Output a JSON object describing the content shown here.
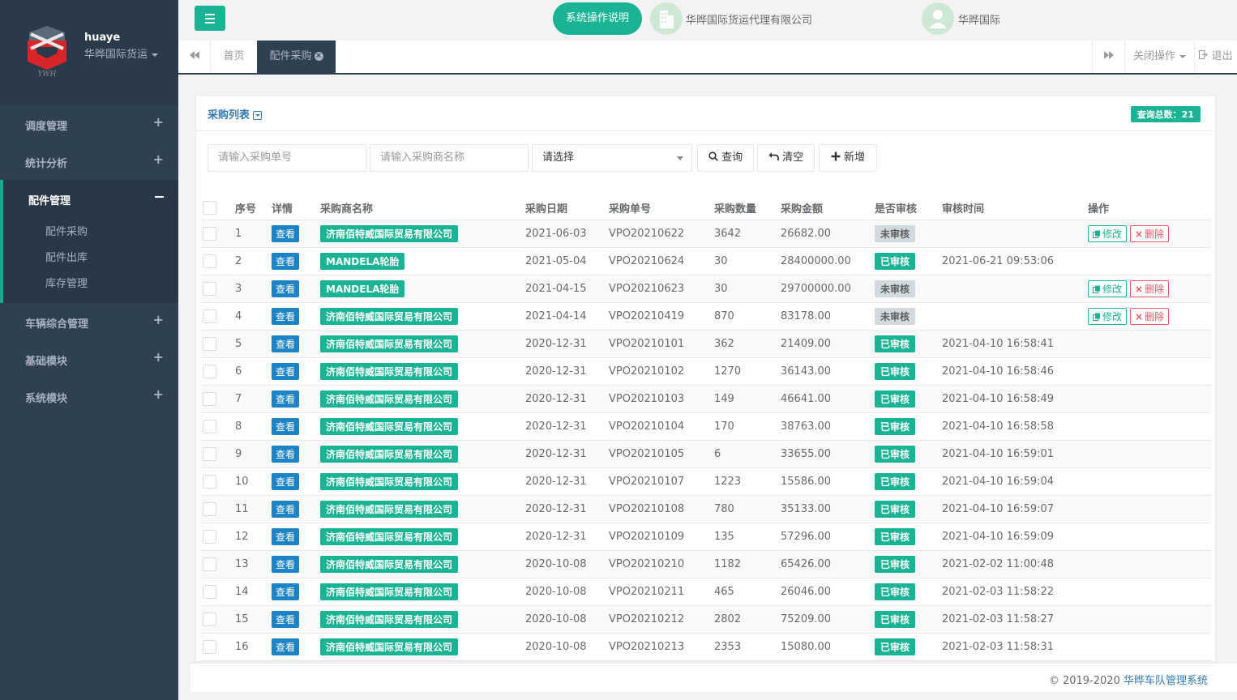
{
  "sidebar": {
    "user": "huaye",
    "org": "华晔国际货运",
    "menu": [
      {
        "label": "调度管理",
        "icon": "plus-icon"
      },
      {
        "label": "统计分析",
        "icon": "plus-icon"
      }
    ],
    "active_group": {
      "label": "配件管理",
      "items": [
        "配件采购",
        "配件出库",
        "库存管理"
      ]
    },
    "menu_after": [
      {
        "label": "车辆综合管理"
      },
      {
        "label": "基础模块"
      },
      {
        "label": "系统模块"
      }
    ]
  },
  "topbar": {
    "help_label": "系统操作说明",
    "company": "华晔国际货运代理有限公司",
    "user_label": "华晔国际"
  },
  "tabs": {
    "home": "首页",
    "active": "配件采购",
    "close_ops": "关闭操作",
    "logout": "退出"
  },
  "panel": {
    "title": "采购列表",
    "count_label": "查询总数：21"
  },
  "search": {
    "order_placeholder": "请输入采购单号",
    "supplier_placeholder": "请输入采购商名称",
    "select_value": "请选择",
    "query_label": "查询",
    "clear_label": "清空",
    "add_label": "新增"
  },
  "table": {
    "headers": [
      "序号",
      "详情",
      "采购商名称",
      "采购日期",
      "采购单号",
      "采购数量",
      "采购金额",
      "是否审核",
      "审核时间",
      "操作"
    ],
    "view_label": "查看",
    "edit_label": "修改",
    "delete_label": "删除",
    "rows": [
      {
        "no": "1",
        "supplier": "济南佰特威国际贸易有限公司",
        "date": "2021-06-03",
        "order": "VPO20210622",
        "qty": "3642",
        "amount": "26682.00",
        "status": "未审核",
        "approved": false,
        "time": ""
      },
      {
        "no": "2",
        "supplier": "MANDELA轮胎",
        "date": "2021-05-04",
        "order": "VPO20210624",
        "qty": "30",
        "amount": "28400000.00",
        "status": "已审核",
        "approved": true,
        "time": "2021-06-21 09:53:06"
      },
      {
        "no": "3",
        "supplier": "MANDELA轮胎",
        "date": "2021-04-15",
        "order": "VPO20210623",
        "qty": "30",
        "amount": "29700000.00",
        "status": "未审核",
        "approved": false,
        "time": ""
      },
      {
        "no": "4",
        "supplier": "济南佰特威国际贸易有限公司",
        "date": "2021-04-14",
        "order": "VPO20210419",
        "qty": "870",
        "amount": "83178.00",
        "status": "未审核",
        "approved": false,
        "time": ""
      },
      {
        "no": "5",
        "supplier": "济南佰特威国际贸易有限公司",
        "date": "2020-12-31",
        "order": "VPO20210101",
        "qty": "362",
        "amount": "21409.00",
        "status": "已审核",
        "approved": true,
        "time": "2021-04-10 16:58:41"
      },
      {
        "no": "6",
        "supplier": "济南佰特威国际贸易有限公司",
        "date": "2020-12-31",
        "order": "VPO20210102",
        "qty": "1270",
        "amount": "36143.00",
        "status": "已审核",
        "approved": true,
        "time": "2021-04-10 16:58:46"
      },
      {
        "no": "7",
        "supplier": "济南佰特威国际贸易有限公司",
        "date": "2020-12-31",
        "order": "VPO20210103",
        "qty": "149",
        "amount": "46641.00",
        "status": "已审核",
        "approved": true,
        "time": "2021-04-10 16:58:49"
      },
      {
        "no": "8",
        "supplier": "济南佰特威国际贸易有限公司",
        "date": "2020-12-31",
        "order": "VPO20210104",
        "qty": "170",
        "amount": "38763.00",
        "status": "已审核",
        "approved": true,
        "time": "2021-04-10 16:58:58"
      },
      {
        "no": "9",
        "supplier": "济南佰特威国际贸易有限公司",
        "date": "2020-12-31",
        "order": "VPO20210105",
        "qty": "6",
        "amount": "33655.00",
        "status": "已审核",
        "approved": true,
        "time": "2021-04-10 16:59:01"
      },
      {
        "no": "10",
        "supplier": "济南佰特威国际贸易有限公司",
        "date": "2020-12-31",
        "order": "VPO20210107",
        "qty": "1223",
        "amount": "15586.00",
        "status": "已审核",
        "approved": true,
        "time": "2021-04-10 16:59:04"
      },
      {
        "no": "11",
        "supplier": "济南佰特威国际贸易有限公司",
        "date": "2020-12-31",
        "order": "VPO20210108",
        "qty": "780",
        "amount": "35133.00",
        "status": "已审核",
        "approved": true,
        "time": "2021-04-10 16:59:07"
      },
      {
        "no": "12",
        "supplier": "济南佰特威国际贸易有限公司",
        "date": "2020-12-31",
        "order": "VPO20210109",
        "qty": "135",
        "amount": "57296.00",
        "status": "已审核",
        "approved": true,
        "time": "2021-04-10 16:59:09"
      },
      {
        "no": "13",
        "supplier": "济南佰特威国际贸易有限公司",
        "date": "2020-10-08",
        "order": "VPO20210210",
        "qty": "1182",
        "amount": "65426.00",
        "status": "已审核",
        "approved": true,
        "time": "2021-02-02 11:00:48"
      },
      {
        "no": "14",
        "supplier": "济南佰特威国际贸易有限公司",
        "date": "2020-10-08",
        "order": "VPO20210211",
        "qty": "465",
        "amount": "26046.00",
        "status": "已审核",
        "approved": true,
        "time": "2021-02-03 11:58:22"
      },
      {
        "no": "15",
        "supplier": "济南佰特威国际贸易有限公司",
        "date": "2020-10-08",
        "order": "VPO20210212",
        "qty": "2802",
        "amount": "75209.00",
        "status": "已审核",
        "approved": true,
        "time": "2021-02-03 11:58:27"
      },
      {
        "no": "16",
        "supplier": "济南佰特威国际贸易有限公司",
        "date": "2020-10-08",
        "order": "VPO20210213",
        "qty": "2353",
        "amount": "15080.00",
        "status": "已审核",
        "approved": true,
        "time": "2021-02-03 11:58:31"
      }
    ]
  },
  "footer": {
    "copyright": "© 2019-2020 ",
    "brand": "华晔车队管理系统"
  },
  "colors": {
    "sidebar": "#2f4050",
    "accent": "#1ab394",
    "primary": "#1c84c6",
    "danger": "#ed5565"
  }
}
